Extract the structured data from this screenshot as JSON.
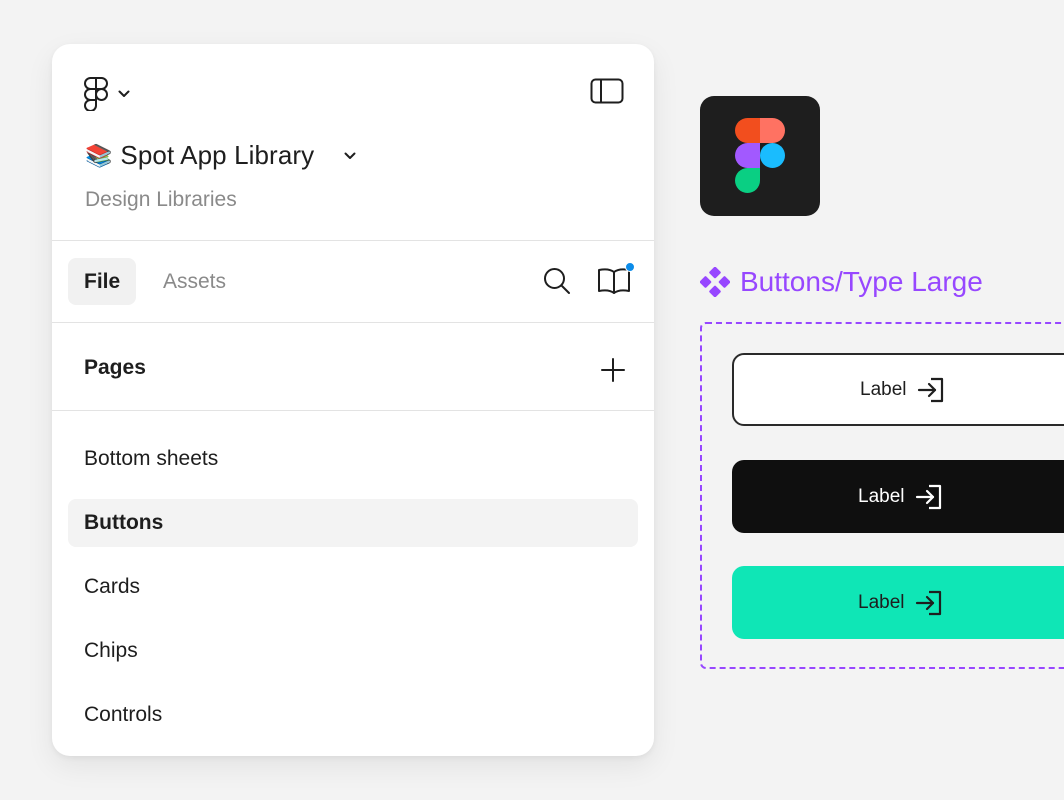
{
  "file": {
    "emoji": "📚",
    "name": "Spot App Library",
    "subtitle": "Design Libraries"
  },
  "tabs": [
    {
      "label": "File",
      "active": true
    },
    {
      "label": "Assets",
      "active": false
    }
  ],
  "icons": {
    "menu": "figma-logo-icon",
    "menu_chevron": "chevron-down-icon",
    "sidebar_toggle": "sidebar-toggle-icon",
    "search": "search-icon",
    "library": "book-open-icon",
    "add": "plus-icon",
    "button_trailing": "arrow-right-to-bracket-icon",
    "component": "component-icon"
  },
  "pages": {
    "title": "Pages",
    "items": [
      {
        "label": "Bottom sheets",
        "selected": false
      },
      {
        "label": "Buttons",
        "selected": true
      },
      {
        "label": "Cards",
        "selected": false
      },
      {
        "label": "Chips",
        "selected": false
      },
      {
        "label": "Controls",
        "selected": false
      }
    ]
  },
  "canvas": {
    "component_name": "Buttons/Type Large",
    "variants": [
      {
        "label": "Label",
        "style": "outline"
      },
      {
        "label": "Label",
        "style": "dark"
      },
      {
        "label": "Label",
        "style": "accent"
      }
    ]
  },
  "colors": {
    "component_purple": "#9747ff",
    "accent_teal": "#0fe6b6",
    "notification_blue": "#0c8ce9",
    "app_icon_bg": "#1e1e1e"
  }
}
